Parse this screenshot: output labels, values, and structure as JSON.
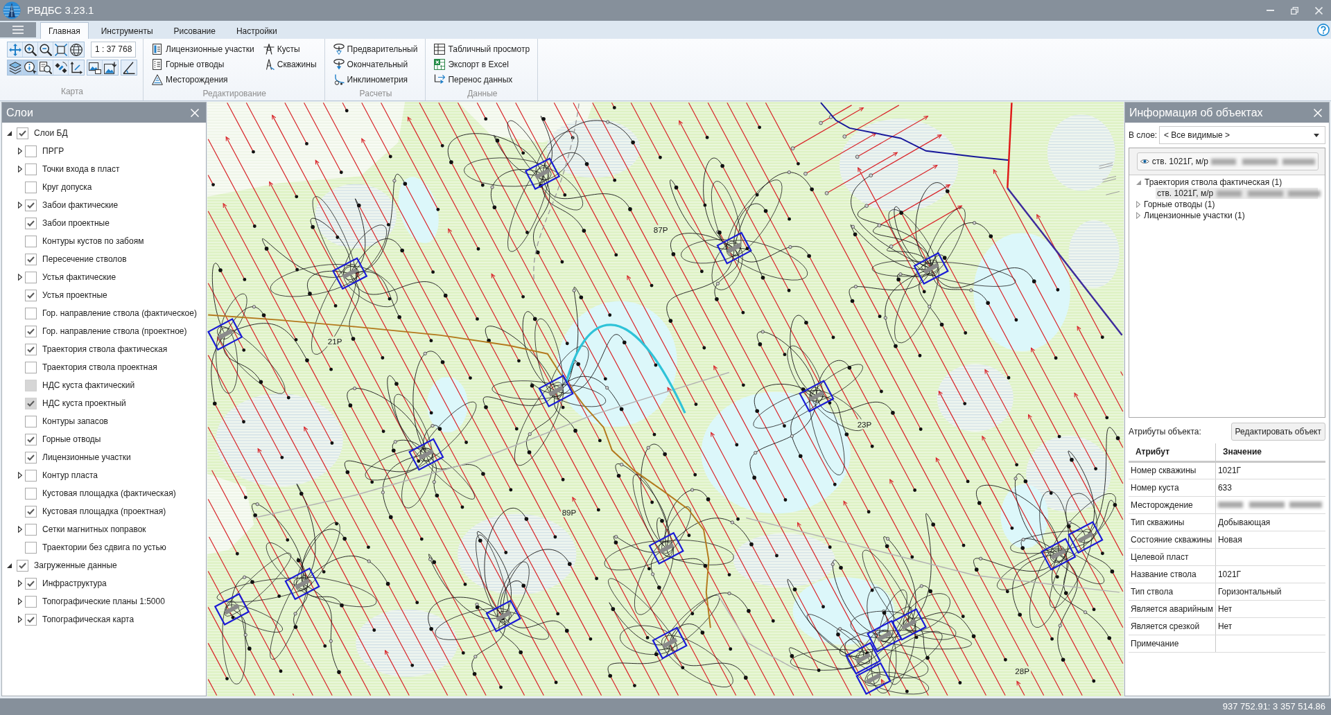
{
  "window": {
    "title": "РВДБС 3.23.1"
  },
  "ribbon": {
    "tabs": [
      {
        "label": "Главная",
        "selected": true
      },
      {
        "label": "Инструменты",
        "selected": false
      },
      {
        "label": "Рисование",
        "selected": false
      },
      {
        "label": "Настройки",
        "selected": false
      }
    ],
    "groups": [
      {
        "kind": "map_tools",
        "label": "Карта",
        "tool_rows": [
          {
            "strips": [
              [
                {
                  "active": false
                },
                {
                  "active": false
                },
                {
                  "active": false
                },
                {
                  "active": false
                },
                {
                  "active": false
                }
              ]
            ],
            "scale": "1 : 37 768"
          },
          {
            "strips": [
              [
                {
                  "active": true
                },
                {
                  "active": true
                },
                {
                  "active": false
                },
                {
                  "active": false
                },
                {
                  "active": false
                }
              ],
              [
                {
                  "active": false
                },
                {
                  "active": false
                }
              ],
              [
                {
                  "active": false
                }
              ]
            ]
          }
        ]
      },
      {
        "kind": "commands",
        "label": "Редактирование",
        "columns": [
          [
            "Лицензионные участки",
            "Горные отводы",
            "Месторождения"
          ],
          [
            "Кусты",
            "Скважины"
          ]
        ]
      },
      {
        "kind": "commands",
        "label": "Расчеты",
        "columns": [
          [
            "Предварительный",
            "Окончательный",
            "Инклинометрия"
          ]
        ]
      },
      {
        "kind": "commands",
        "label": "Данные",
        "columns": [
          [
            "Табличный просмотр",
            "Экспорт в Excel",
            "Перенос данных"
          ]
        ]
      }
    ]
  },
  "layers_panel": {
    "title": "Слои",
    "layers": [
      {
        "label": "Слои БД",
        "checked": true,
        "disabled": false,
        "expanded": true,
        "children": [
          {
            "label": "ПРГР",
            "checked": false,
            "disabled": false,
            "expanded": false
          },
          {
            "label": "Точки входа в пласт",
            "checked": false,
            "disabled": false,
            "expanded": false
          },
          {
            "label": "Круг допуска",
            "checked": false,
            "disabled": false
          },
          {
            "label": "Забои фактические",
            "checked": true,
            "disabled": false,
            "expanded": false
          },
          {
            "label": "Забои проектные",
            "checked": true,
            "disabled": false
          },
          {
            "label": "Контуры кустов по забоям",
            "checked": false,
            "disabled": false
          },
          {
            "label": "Пересечение стволов",
            "checked": true,
            "disabled": false
          },
          {
            "label": "Устья фактические",
            "checked": false,
            "disabled": false,
            "expanded": false
          },
          {
            "label": "Устья проектные",
            "checked": true,
            "disabled": false
          },
          {
            "label": "Гор. направление ствола (фактическое)",
            "checked": false,
            "disabled": false
          },
          {
            "label": "Гор. направление ствола (проектное)",
            "checked": true,
            "disabled": false
          },
          {
            "label": "Траектория ствола фактическая",
            "checked": true,
            "disabled": false
          },
          {
            "label": "Траектория ствола проектная",
            "checked": false,
            "disabled": false
          },
          {
            "label": "НДС куста фактический",
            "checked": false,
            "disabled": true
          },
          {
            "label": "НДС куста проектный",
            "checked": true,
            "disabled": true
          },
          {
            "label": "Контуры запасов",
            "checked": false,
            "disabled": false
          },
          {
            "label": "Горные отводы",
            "checked": true,
            "disabled": false
          },
          {
            "label": "Лицензионные участки",
            "checked": true,
            "disabled": false
          },
          {
            "label": "Контур пласта",
            "checked": false,
            "disabled": false,
            "expanded": false
          },
          {
            "label": "Кустовая площадка (фактическая)",
            "checked": false,
            "disabled": false
          },
          {
            "label": "Кустовая площадка (проектная)",
            "checked": true,
            "disabled": false
          },
          {
            "label": "Сетки магнитных поправок",
            "checked": false,
            "disabled": false,
            "expanded": false
          },
          {
            "label": "Траектории без сдвига по устью",
            "checked": false,
            "disabled": false
          }
        ]
      },
      {
        "label": "Загруженные данные",
        "checked": true,
        "disabled": false,
        "expanded": true,
        "children": [
          {
            "label": "Инфраструктура",
            "checked": true,
            "disabled": false,
            "expanded": false
          },
          {
            "label": "Топографические планы 1:5000",
            "checked": false,
            "disabled": false,
            "expanded": false
          },
          {
            "label": "Топографическая карта",
            "checked": true,
            "disabled": false,
            "expanded": false
          }
        ]
      }
    ]
  },
  "map": {
    "labels": [
      "87Р",
      "21Р",
      "23Р",
      "89Р",
      "28Р"
    ]
  },
  "info_panel": {
    "title": "Информация об объектах",
    "layer_filter": {
      "label": "В слое:",
      "value": "< Все видимые >"
    },
    "pinned_object": {
      "label": "ств. 1021Г, м/р",
      "redacted": true
    },
    "object_tree": [
      {
        "label": "Траектория ствола фактическая (1)",
        "expanded": true,
        "selected": false,
        "children": [
          {
            "label": "ств. 1021Г, м/р",
            "redacted": true,
            "selected": true
          }
        ]
      },
      {
        "label": "Горные отводы (1)",
        "expanded": false,
        "selected": false
      },
      {
        "label": "Лицензионные участки (1)",
        "expanded": false,
        "selected": false
      }
    ],
    "attributes_label": "Атрибуты объекта:",
    "edit_button": "Редактировать объект",
    "table": {
      "columns": [
        "Атрибут",
        "Значение"
      ],
      "rows": [
        {
          "attribute": "Номер скважины",
          "value": "1021Г"
        },
        {
          "attribute": "Номер куста",
          "value": "633"
        },
        {
          "attribute": "Месторождение",
          "redacted": true
        },
        {
          "attribute": "Тип скважины",
          "value": "Добывающая"
        },
        {
          "attribute": "Состояние скважины",
          "value": "Новая"
        },
        {
          "attribute": "Целевой пласт"
        },
        {
          "attribute": "Название ствола",
          "value": "1021Г"
        },
        {
          "attribute": "Тип ствола",
          "value": "Горизонтальный"
        },
        {
          "attribute": "Является аварийным",
          "value": "Нет"
        },
        {
          "attribute": "Является срезкой",
          "value": "Нет"
        },
        {
          "attribute": "Примечание"
        }
      ]
    }
  },
  "status_bar": {
    "coordinates": "937 752.91: 3 357 514.86"
  }
}
